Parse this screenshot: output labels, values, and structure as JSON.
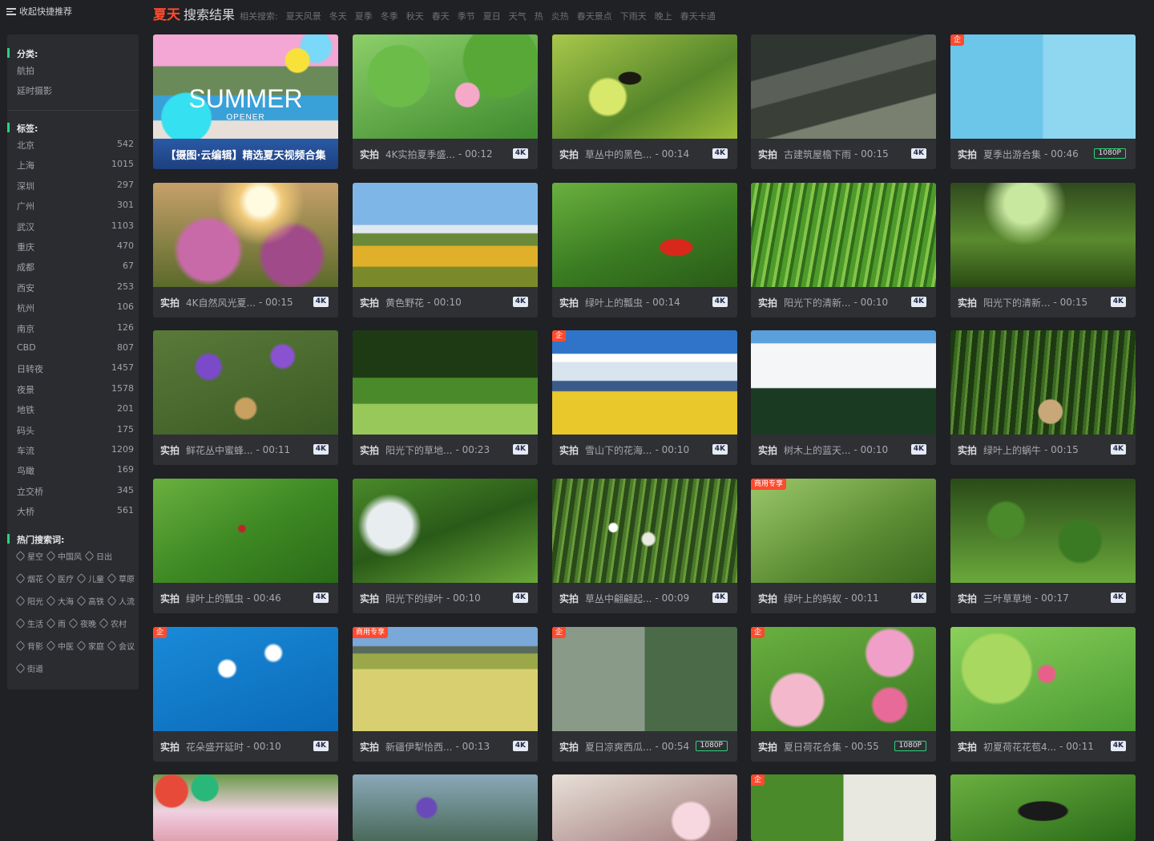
{
  "top": {
    "collapse_label": "收起快捷推荐"
  },
  "header": {
    "keyword": "夏天",
    "results_label": "搜索结果",
    "related_label": "相关搜索:",
    "related": [
      "夏天风景",
      "冬天",
      "夏季",
      "冬季",
      "秋天",
      "春天",
      "季节",
      "夏日",
      "天气",
      "热",
      "炎热",
      "春天景点",
      "下雨天",
      "晚上",
      "春天卡通"
    ]
  },
  "sidebar": {
    "category_title": "分类:",
    "categories": [
      "航拍",
      "延时摄影"
    ],
    "tags_title": "标签:",
    "tags": [
      {
        "name": "北京",
        "count": "542"
      },
      {
        "name": "上海",
        "count": "1015"
      },
      {
        "name": "深圳",
        "count": "297"
      },
      {
        "name": "广州",
        "count": "301"
      },
      {
        "name": "武汉",
        "count": "1103"
      },
      {
        "name": "重庆",
        "count": "470"
      },
      {
        "name": "成都",
        "count": "67"
      },
      {
        "name": "西安",
        "count": "253"
      },
      {
        "name": "杭州",
        "count": "106"
      },
      {
        "name": "南京",
        "count": "126"
      },
      {
        "name": "CBD",
        "count": "807"
      },
      {
        "name": "日转夜",
        "count": "1457"
      },
      {
        "name": "夜景",
        "count": "1578"
      },
      {
        "name": "地铁",
        "count": "201"
      },
      {
        "name": "码头",
        "count": "175"
      },
      {
        "name": "车流",
        "count": "1209"
      },
      {
        "name": "鸟瞰",
        "count": "169"
      },
      {
        "name": "立交桥",
        "count": "345"
      },
      {
        "name": "大桥",
        "count": "561"
      }
    ],
    "hot_title": "热门搜索词:",
    "hot_rows": [
      [
        "星空",
        "中国风",
        "日出"
      ],
      [
        "烟花",
        "医疗",
        "儿童",
        "草原"
      ],
      [
        "阳光",
        "大海",
        "高铁",
        "人流"
      ],
      [
        "生活",
        "雨",
        "夜晚",
        "农村"
      ],
      [
        "背影",
        "中医",
        "家庭",
        "会议"
      ],
      [
        "街道"
      ]
    ]
  },
  "cards_label_prefix": "实拍",
  "featured": {
    "headline": "SUMMER",
    "sub": "OPENER",
    "caption": "【摄图·云编辑】精选夏天视频合集"
  },
  "cards": [
    {
      "title": "4K实拍夏季盛...",
      "duration": "- 00:12",
      "res": "4K",
      "corner": "",
      "bg": "lotus"
    },
    {
      "title": "草丛中的黑色...",
      "duration": "- 00:14",
      "res": "4K",
      "corner": "",
      "bg": "butterfly"
    },
    {
      "title": "古建筑屋檐下雨",
      "duration": "- 00:15",
      "res": "4K",
      "corner": "",
      "bg": "rain"
    },
    {
      "title": "夏季出游合集",
      "duration": "- 00:46",
      "res": "1080P",
      "corner": "企",
      "bg": "pool"
    },
    {
      "title": "4K自然风光夏...",
      "duration": "- 00:15",
      "res": "4K",
      "corner": "",
      "bg": "pinkflower"
    },
    {
      "title": "黄色野花",
      "duration": "- 00:10",
      "res": "4K",
      "corner": "",
      "bg": "yellowflower"
    },
    {
      "title": "绿叶上的瓢虫",
      "duration": "- 00:14",
      "res": "4K",
      "corner": "",
      "bg": "ladybug"
    },
    {
      "title": "阳光下的清新...",
      "duration": "- 00:10",
      "res": "4K",
      "corner": "",
      "bg": "grass"
    },
    {
      "title": "阳光下的清新...",
      "duration": "- 00:15",
      "res": "4K",
      "corner": "",
      "bg": "meadow"
    },
    {
      "title": "鲜花丛中蜜蜂...",
      "duration": "- 00:11",
      "res": "4K",
      "corner": "",
      "bg": "purple"
    },
    {
      "title": "阳光下的草地...",
      "duration": "- 00:23",
      "res": "4K",
      "corner": "",
      "bg": "forest"
    },
    {
      "title": "雪山下的花海...",
      "duration": "- 00:10",
      "res": "4K",
      "corner": "企",
      "bg": "snow"
    },
    {
      "title": "树木上的蓝天...",
      "duration": "- 00:10",
      "res": "4K",
      "corner": "",
      "bg": "clouds"
    },
    {
      "title": "绿叶上的蜗牛",
      "duration": "- 00:15",
      "res": "4K",
      "corner": "",
      "bg": "snail"
    },
    {
      "title": "绿叶上的瓢虫",
      "duration": "- 00:46",
      "res": "4K",
      "corner": "",
      "bg": "leaf"
    },
    {
      "title": "阳光下的绿叶",
      "duration": "- 00:10",
      "res": "4K",
      "corner": "",
      "bg": "leaves"
    },
    {
      "title": "草丛中翩翩起...",
      "duration": "- 00:09",
      "res": "4K",
      "corner": "",
      "bg": "dandelion"
    },
    {
      "title": "绿叶上的蚂蚁",
      "duration": "- 00:11",
      "res": "4K",
      "corner": "商用专享",
      "bg": "ant"
    },
    {
      "title": "三叶草草地",
      "duration": "- 00:17",
      "res": "4K",
      "corner": "",
      "bg": "clover"
    },
    {
      "title": "花朵盛开延时",
      "duration": "- 00:10",
      "res": "4K",
      "corner": "企",
      "bg": "bloom"
    },
    {
      "title": "新疆伊犁恰西...",
      "duration": "- 00:13",
      "res": "4K",
      "corner": "商用专享",
      "bg": "field"
    },
    {
      "title": "夏日凉爽西瓜...",
      "duration": "- 00:54",
      "res": "1080P",
      "corner": "企",
      "bg": "melon"
    },
    {
      "title": "夏日荷花合集",
      "duration": "- 00:55",
      "res": "1080P",
      "corner": "企",
      "bg": "lotus2"
    },
    {
      "title": "初夏荷花花苞4...",
      "duration": "- 00:11",
      "res": "4K",
      "corner": "",
      "bg": "lotusbud"
    }
  ],
  "bottom_row": [
    {
      "corner": "",
      "bg": "party"
    },
    {
      "corner": "",
      "bg": "violet"
    },
    {
      "corner": "",
      "bg": "blossom"
    },
    {
      "corner": "企",
      "bg": "collage"
    },
    {
      "corner": "",
      "bg": "blackbutterfly"
    }
  ]
}
